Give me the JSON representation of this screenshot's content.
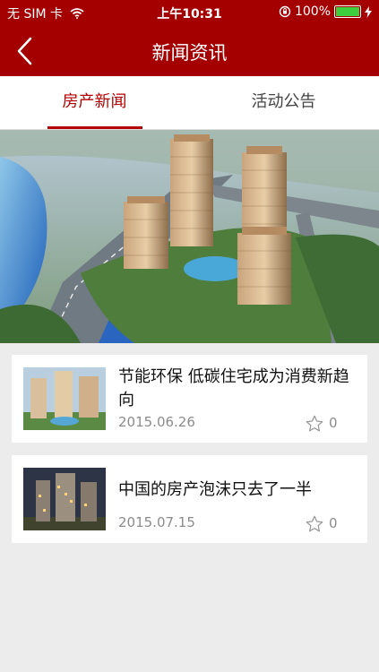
{
  "status_bar": {
    "carrier": "无 SIM 卡",
    "time": "上午10:31",
    "battery": "100%"
  },
  "header": {
    "title": "新闻资讯"
  },
  "tabs": [
    {
      "label": "房产新闻",
      "active": true
    },
    {
      "label": "活动公告",
      "active": false
    }
  ],
  "news": [
    {
      "title": "节能环保 低碳住宅成为消费新趋向",
      "date": "2015.06.26",
      "likes": "0"
    },
    {
      "title": "中国的房产泡沫只去了一半",
      "date": "2015.07.15",
      "likes": "0"
    }
  ],
  "colors": {
    "brand": "#a50000",
    "tab_active": "#b30000",
    "background": "#ececec"
  }
}
